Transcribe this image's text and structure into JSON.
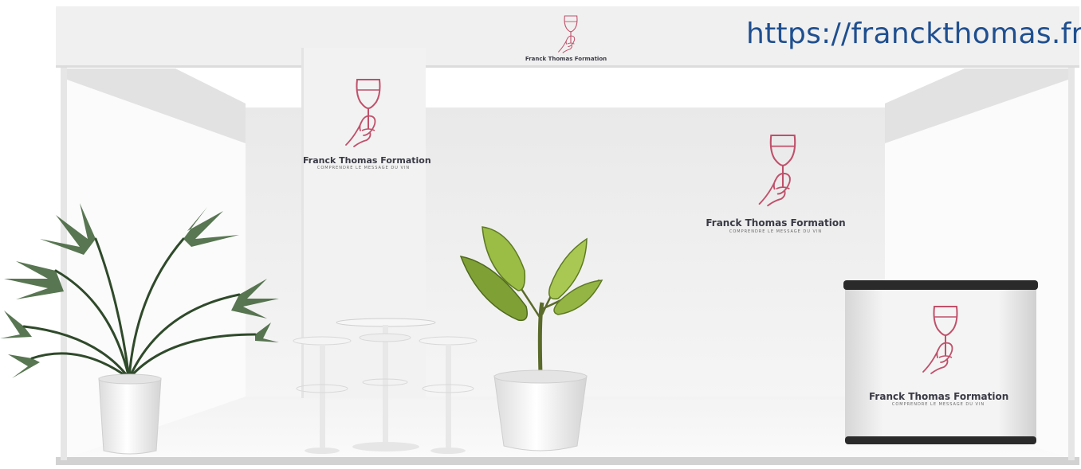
{
  "booth": {
    "url": "https://franckthomas.fr/",
    "brand_name": "Franck Thomas Formation",
    "brand_tagline": "COMPRENDRE LE MESSAGE DU VIN"
  },
  "colors": {
    "url_blue": "#1f4f8f",
    "logo_rose": "#c0506a",
    "brand_text": "#3a3a46",
    "wall": "#efefef",
    "counter_top": "#2a2a2a"
  },
  "icons": {
    "logo": "wine-glass-hand-icon"
  }
}
